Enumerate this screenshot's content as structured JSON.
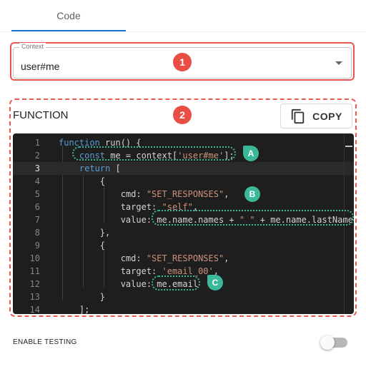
{
  "tabs": [
    {
      "label": "Code",
      "active": true
    }
  ],
  "context": {
    "legend": "Context",
    "value": "user#me"
  },
  "badges": {
    "one": "1",
    "two": "2"
  },
  "function_panel": {
    "title": "FUNCTION",
    "copy_label": "COPY",
    "copy_icon": "copy-icon"
  },
  "editor": {
    "current_line": 3,
    "line_numbers": [
      "1",
      "2",
      "3",
      "4",
      "5",
      "6",
      "7",
      "8",
      "9",
      "10",
      "11",
      "12",
      "13",
      "14"
    ],
    "lines": [
      [
        {
          "t": "function",
          "c": "kw"
        },
        {
          "t": " run() {"
        }
      ],
      [
        {
          "t": "    "
        },
        {
          "t": "const",
          "c": "kw"
        },
        {
          "t": " me = context["
        },
        {
          "t": "'user#me'",
          "c": "str"
        },
        {
          "t": "];"
        }
      ],
      [
        {
          "t": "    "
        },
        {
          "t": "return",
          "c": "kw"
        },
        {
          "t": " ["
        }
      ],
      [
        {
          "t": "        {"
        }
      ],
      [
        {
          "t": "            cmd: "
        },
        {
          "t": "\"SET_RESPONSES\"",
          "c": "str"
        },
        {
          "t": ","
        }
      ],
      [
        {
          "t": "            target: "
        },
        {
          "t": "\"self\"",
          "c": "str"
        },
        {
          "t": ","
        }
      ],
      [
        {
          "t": "            value: me.name.names + "
        },
        {
          "t": "\" \"",
          "c": "str"
        },
        {
          "t": " + me.name.lastName"
        }
      ],
      [
        {
          "t": "        },"
        }
      ],
      [
        {
          "t": "        {"
        }
      ],
      [
        {
          "t": "            cmd: "
        },
        {
          "t": "\"SET_RESPONSES\"",
          "c": "str"
        },
        {
          "t": ","
        }
      ],
      [
        {
          "t": "            target: "
        },
        {
          "t": "'email_00'",
          "c": "str"
        },
        {
          "t": ","
        }
      ],
      [
        {
          "t": "            value: me.email"
        }
      ],
      [
        {
          "t": "        }"
        }
      ],
      [
        {
          "t": "    ];"
        }
      ]
    ]
  },
  "annotations": {
    "a": "A",
    "b": "B",
    "c": "C"
  },
  "testing": {
    "label": "ENABLE TESTING",
    "enabled": false
  },
  "colors": {
    "accent": "#1976d2",
    "callout_red": "#e9574f",
    "callout_teal": "#3bb79a",
    "editor_bg": "#1e1e1e"
  }
}
